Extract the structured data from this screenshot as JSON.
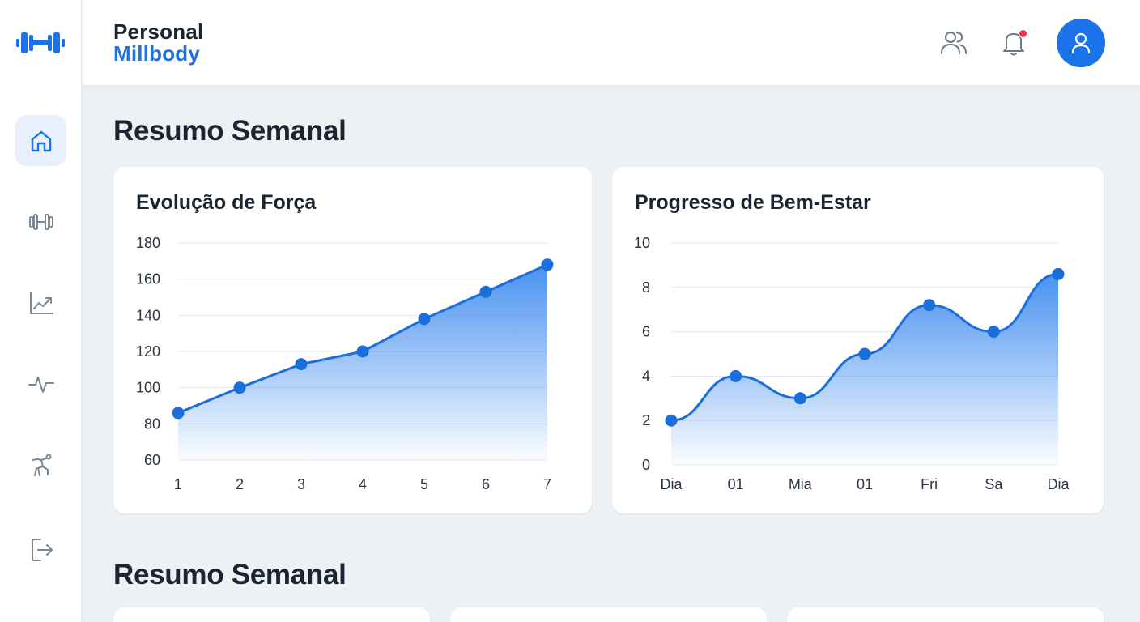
{
  "brand": {
    "line1": "Personal",
    "line2": "Millbody"
  },
  "sidebar": {
    "items": [
      {
        "icon": "home-icon",
        "active": true
      },
      {
        "icon": "dumbbell-icon",
        "active": false
      },
      {
        "icon": "trending-chart-icon",
        "active": false
      },
      {
        "icon": "activity-pulse-icon",
        "active": false
      },
      {
        "icon": "stretch-icon",
        "active": false
      },
      {
        "icon": "logout-icon",
        "active": false
      }
    ]
  },
  "header": {
    "icons": [
      "users-icon",
      "bell-icon",
      "user-avatar-icon"
    ],
    "notification_badge": true
  },
  "colors": {
    "accent": "#1a73e8",
    "brand_blue": "#1e72d9",
    "badge": "#e53945",
    "background": "#eef1f4"
  },
  "sections": [
    {
      "title": "Resumo Semanal"
    },
    {
      "title": "Resumo Semanal"
    }
  ],
  "chart_data": [
    {
      "type": "area",
      "title": "Evolução de Força",
      "categories": [
        "1",
        "2",
        "3",
        "4",
        "5",
        "6",
        "7"
      ],
      "values": [
        86,
        100,
        113,
        120,
        138,
        153,
        168
      ],
      "ylim": [
        60,
        180
      ],
      "yticks": [
        "180",
        "160",
        "140",
        "120",
        "100",
        "80",
        "60"
      ],
      "grid": true,
      "curve": "straight"
    },
    {
      "type": "area",
      "title": "Progresso de Bem-Estar",
      "categories": [
        "Dia",
        "01",
        "Mia",
        "01",
        "Fri",
        "Sa",
        "Dia"
      ],
      "values": [
        2,
        4,
        3,
        5,
        7.2,
        6,
        8.6
      ],
      "ylim": [
        0,
        10
      ],
      "yticks": [
        "10",
        "8",
        "6",
        "4",
        "2",
        "0"
      ],
      "grid": true,
      "curve": "smooth"
    }
  ]
}
